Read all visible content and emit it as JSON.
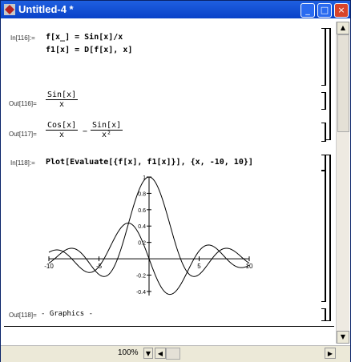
{
  "window": {
    "title": "Untitled-4 *",
    "buttons": {
      "minimize": "_",
      "maximize": "□",
      "close": "×"
    }
  },
  "cells": {
    "in116_label": "In[116]:=",
    "in116_line1": "f[x_] = Sin[x]/x",
    "in116_line2": "f1[x] = D[f[x], x]",
    "out116_label": "Out[116]=",
    "out116_num": "Sin[x]",
    "out116_den": "x",
    "out117_label": "Out[117]=",
    "out117_num1": "Cos[x]",
    "out117_den1": "x",
    "out117_minus": "−",
    "out117_num2": "Sin[x]",
    "out117_den2": "x²",
    "in118_label": "In[118]:=",
    "in118_code": "Plot[Evaluate[{f[x], f1[x]}], {x, -10, 10}]",
    "out118_label": "Out[118]=",
    "out118_text": "- Graphics -"
  },
  "status": {
    "zoom": "100%"
  },
  "chart_data": {
    "type": "line",
    "x_ticks": [
      "-10",
      "-5",
      "5",
      "10"
    ],
    "y_ticks": [
      "1",
      "0.8",
      "0.6",
      "0.4",
      "0.2",
      "-0.2",
      "-0.4"
    ],
    "xlim": [
      -10,
      10
    ],
    "ylim": [
      -0.45,
      1.0
    ],
    "series": [
      {
        "function": "Sin[x]/x",
        "style": "solid"
      },
      {
        "function": "Cos[x]/x - Sin[x]/x^2",
        "style": "solid"
      }
    ]
  }
}
